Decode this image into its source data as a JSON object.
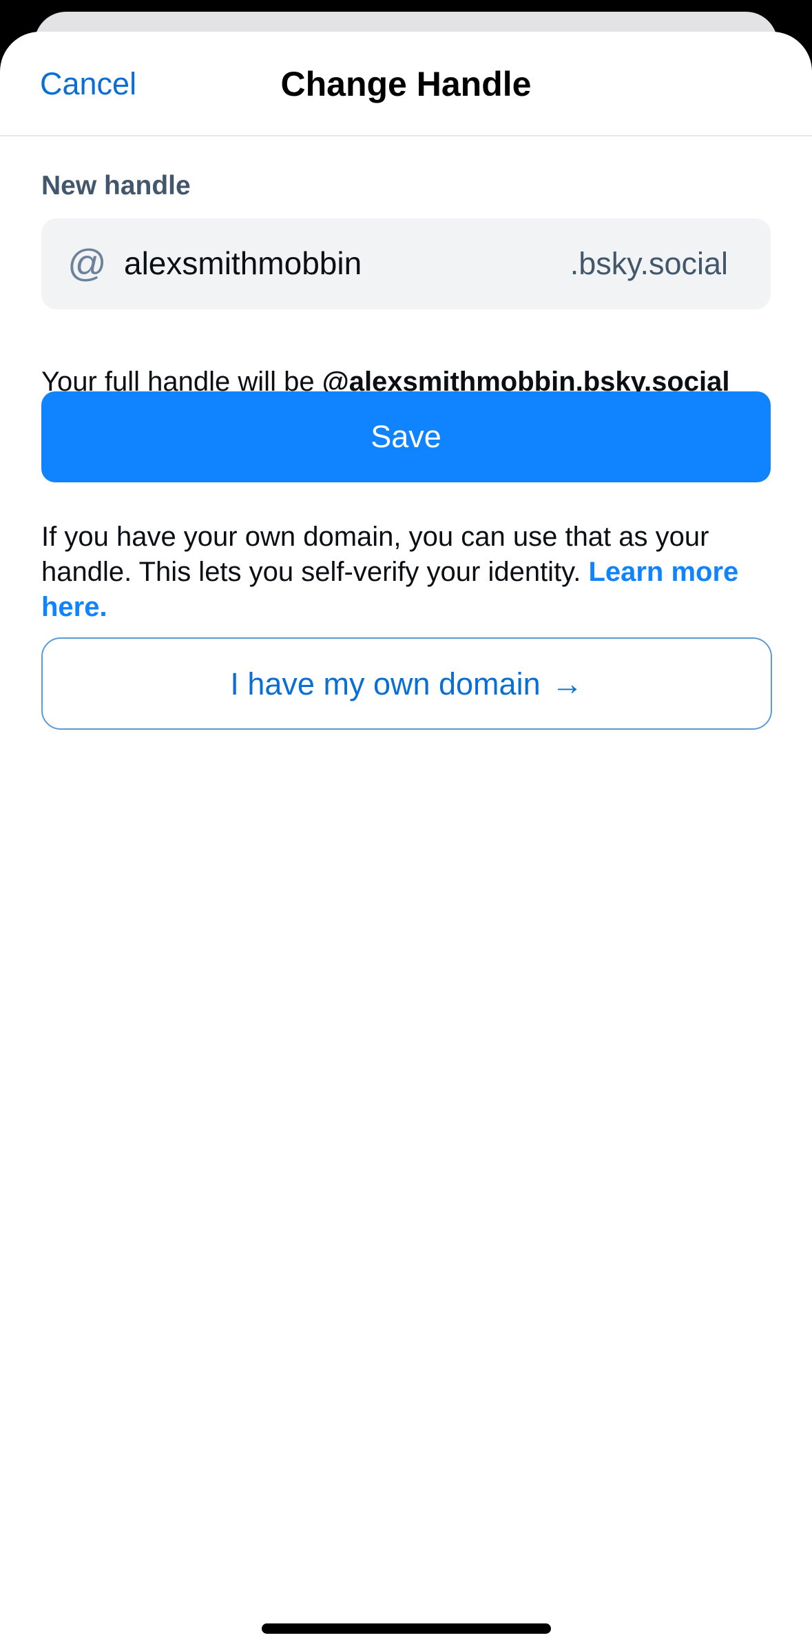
{
  "header": {
    "cancel_label": "Cancel",
    "title": "Change Handle"
  },
  "form": {
    "label": "New handle",
    "at_symbol": "@",
    "handle_value": "alexsmithmobbin",
    "suffix": ".bsky.social",
    "full_handle_prefix": "Your full handle will be ",
    "full_handle_value": "@alexsmithmobbin.bsky.social",
    "save_label": "Save"
  },
  "domain": {
    "info_text": "If you have your own domain, you can use that as your handle. This lets you self-verify your identity. ",
    "learn_more_label": "Learn more here.",
    "button_label": "I have my own domain",
    "arrow": "→"
  },
  "colors": {
    "accent": "#1083fe",
    "link": "#0a6ed3",
    "muted": "#42576c",
    "field_bg": "#f1f3f5"
  }
}
